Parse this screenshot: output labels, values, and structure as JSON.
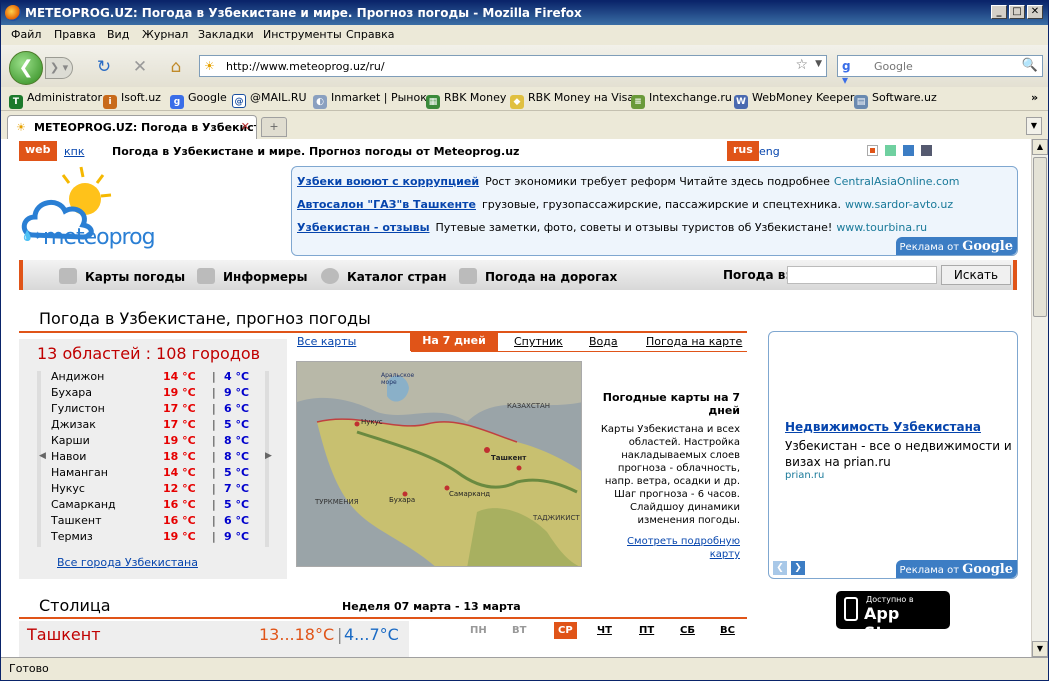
{
  "window": {
    "title": "METEOPROG.UZ: Погода в Узбекистане и мире. Прогноз погоды - Mozilla Firefox"
  },
  "menu": [
    "Файл",
    "Правка",
    "Вид",
    "Журнал",
    "Закладки",
    "Инструменты",
    "Справка"
  ],
  "url": "http://www.meteoprog.uz/ru/",
  "search_placeholder": "Google",
  "bookmarks": [
    "Administrator",
    "Isoft.uz",
    "Google",
    "@MAIL.RU",
    "Inmarket | Рынок",
    "RBK Money",
    "RBK Money на Visa",
    "Intexchange.ru",
    "WebMoney Keeper",
    "Software.uz"
  ],
  "tab": {
    "label": "METEOPROG.UZ: Погода в Узбекист..."
  },
  "status": "Готово",
  "page": {
    "top": {
      "web": "web",
      "kpk": "кпк",
      "headline": "Погода в Узбекистане и мире. Прогноз погоды от Meteoprog.uz",
      "rus": "rus",
      "eng": "eng"
    },
    "logo_text": "meteoprog",
    "ads": [
      {
        "title": "Узбеки воюют с коррупцией",
        "text": "Рост экономики требует реформ Читайте здесь подробнее",
        "url": "CentralAsiaOnline.com"
      },
      {
        "title": "Автосалон \"ГАЗ\"в Ташкенте",
        "text": "грузовые, грузопассажирские, пассажирские и спецтехника.",
        "url": "www.sardor-avto.uz"
      },
      {
        "title": "Узбекистан - отзывы",
        "text": "Путевые заметки, фото, советы и отзывы туристов об Узбекистане!",
        "url": "www.tourbina.ru"
      }
    ],
    "ads_badge_prefix": "Реклама от",
    "ads_badge_brand": "Google",
    "nav": {
      "items": [
        "Карты погоды",
        "Информеры",
        "Каталог стран",
        "Погода на дорогах"
      ],
      "search_label": "Погода в:",
      "search_button": "Искать"
    },
    "section_title": "Погода в Узбекистане, прогноз погоды",
    "regions_header": "13 областей : 108 городов",
    "cities": [
      {
        "name": "Андижон",
        "max": "14 °C",
        "min": "4 °C"
      },
      {
        "name": "Бухара",
        "max": "19 °C",
        "min": "9 °C"
      },
      {
        "name": "Гулистон",
        "max": "17 °C",
        "min": "6 °C"
      },
      {
        "name": "Джизак",
        "max": "17 °C",
        "min": "5 °C"
      },
      {
        "name": "Карши",
        "max": "19 °C",
        "min": "8 °C"
      },
      {
        "name": "Навои",
        "max": "18 °C",
        "min": "8 °C"
      },
      {
        "name": "Наманган",
        "max": "14 °C",
        "min": "5 °C"
      },
      {
        "name": "Нукус",
        "max": "12 °C",
        "min": "7 °C"
      },
      {
        "name": "Самарканд",
        "max": "16 °C",
        "min": "5 °C"
      },
      {
        "name": "Ташкент",
        "max": "16 °C",
        "min": "6 °C"
      },
      {
        "name": "Термиз",
        "max": "19 °C",
        "min": "9 °C"
      }
    ],
    "all_cities_link": "Все города Узбекистана",
    "map_tabs": [
      "Все карты",
      "На 7 дней",
      "Спутник",
      "Вода",
      "Погода на карте"
    ],
    "map_labels": [
      "КАЗАХСТАН",
      "ТУРКМЕНИЯ",
      "ТАДЖИКИСТ",
      "Нукус",
      "Ташкент",
      "Самарканд",
      "Бухара",
      "Аральское море"
    ],
    "map_desc_title": "Погодные карты на 7 дней",
    "map_desc_text": "Карты Узбекистана и всех областей. Настройка накладываемых слоев прогноза - облачность, напр. ветра, осадки и др. Шаг прогноза - 6 часов. Слайдшоу динамики изменения погоды.",
    "map_more_link": "Смотреть подробную карту",
    "right_ad": {
      "title": "Недвижимость Узбекистана",
      "text": "Узбекистан - все о недвижимости и визах на prian.ru",
      "url": "prian.ru"
    },
    "appstore": {
      "small": "Доступно в",
      "big": "App Store"
    },
    "capital_title": "Столица",
    "week_range": "Неделя 07 марта - 13 марта",
    "capital_city": "Ташкент",
    "capital_day": "13...18°C",
    "capital_night": "4...7°C",
    "weekdays": [
      "ПН",
      "ВТ",
      "СР",
      "ЧТ",
      "ПТ",
      "СБ",
      "ВС"
    ]
  },
  "colors": {
    "accent": "#e05418",
    "link": "#0645ad",
    "temp_max": "#e60000",
    "temp_min": "#0000cc"
  }
}
